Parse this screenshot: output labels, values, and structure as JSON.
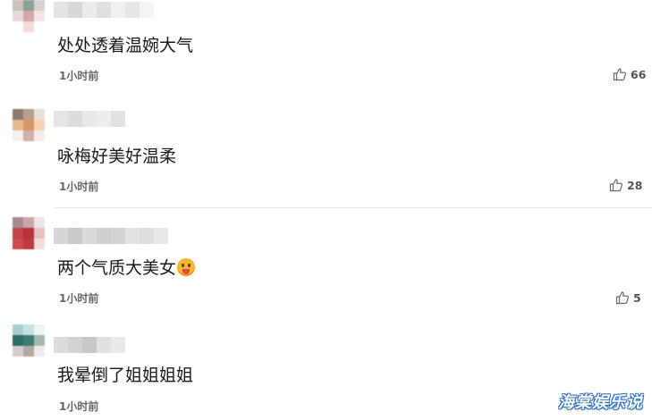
{
  "comments": [
    {
      "text": "处处透着温婉大气",
      "time": "1小时前",
      "likes": "66"
    },
    {
      "text": "咏梅好美好温柔",
      "time": "1小时前",
      "likes": "28"
    },
    {
      "text": "两个气质大美女",
      "time": "1小时前",
      "likes": "5",
      "emoji": "tongue-out-emoji"
    },
    {
      "text": "我晕倒了姐姐姐姐",
      "time": "1小时前"
    }
  ],
  "watermark": "海棠娱乐说",
  "colors": {
    "text": "#1a1a1a",
    "meta": "#666666",
    "watermark_outline": "#2d6fc2"
  }
}
